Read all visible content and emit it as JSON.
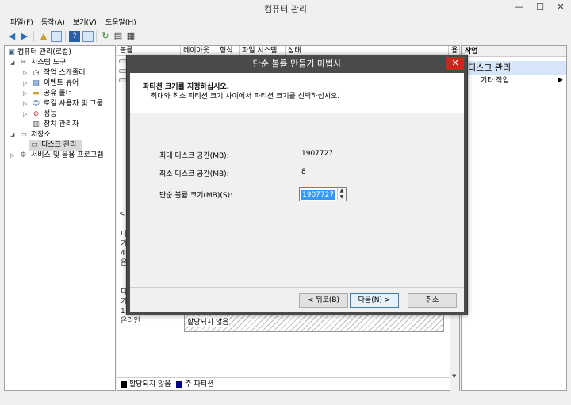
{
  "window": {
    "title": "컴퓨터 관리",
    "min": "—",
    "max": "☐",
    "close": "✕"
  },
  "menu": [
    "파일(F)",
    "동작(A)",
    "보기(V)",
    "도움말(H)"
  ],
  "tree": {
    "items": [
      {
        "label": "컴퓨터 관리(로컬)"
      },
      {
        "label": "시스템 도구"
      },
      {
        "label": "작업 스케줄러"
      },
      {
        "label": "이벤트 뷰어"
      },
      {
        "label": "공유 폴더"
      },
      {
        "label": "로컬 사용자 및 그룹"
      },
      {
        "label": "성능"
      },
      {
        "label": "장치 관리자"
      },
      {
        "label": "저장소"
      },
      {
        "label": "디스크 관리"
      },
      {
        "label": "서비스 및 응용 프로그램"
      }
    ]
  },
  "center": {
    "columns": [
      "볼륨",
      "레이아웃",
      "형식",
      "파일 시스템",
      "상태",
      "용"
    ],
    "disk_labels_a": [
      "디",
      "기",
      "4",
      "온"
    ],
    "disk_labels_b": [
      "디",
      "기",
      "1",
      "온라인"
    ],
    "unallocated_label": "할당되지 않음",
    "legend": {
      "unallocated": "할당되지 않음",
      "primary": "주 파티션"
    }
  },
  "actions": {
    "header": "작업",
    "section": "디스크 관리",
    "item": "기타 작업"
  },
  "dialog": {
    "title": "단순 볼륨 만들기 마법사",
    "close": "✕",
    "heading": "파티션 크기를 지정하십시오.",
    "subheading": "최대와 최소 파티션 크기 사이에서 파티션 크기를 선택하십시오.",
    "max_label": "최대 디스크 공간(MB):",
    "max_value": "1907727",
    "min_label": "최소 디스크 공간(MB):",
    "min_value": "8",
    "size_label": "단순 볼륨 크기(MB)(S):",
    "size_value": "1907727",
    "back": "< 뒤로(B)",
    "next": "다음(N) >",
    "cancel": "취소"
  },
  "colors": {
    "dialog_frame": "#4a4a4a",
    "close_red": "#c42b1c",
    "selection_blue": "#3399ff",
    "primary_partition": "#000080"
  }
}
